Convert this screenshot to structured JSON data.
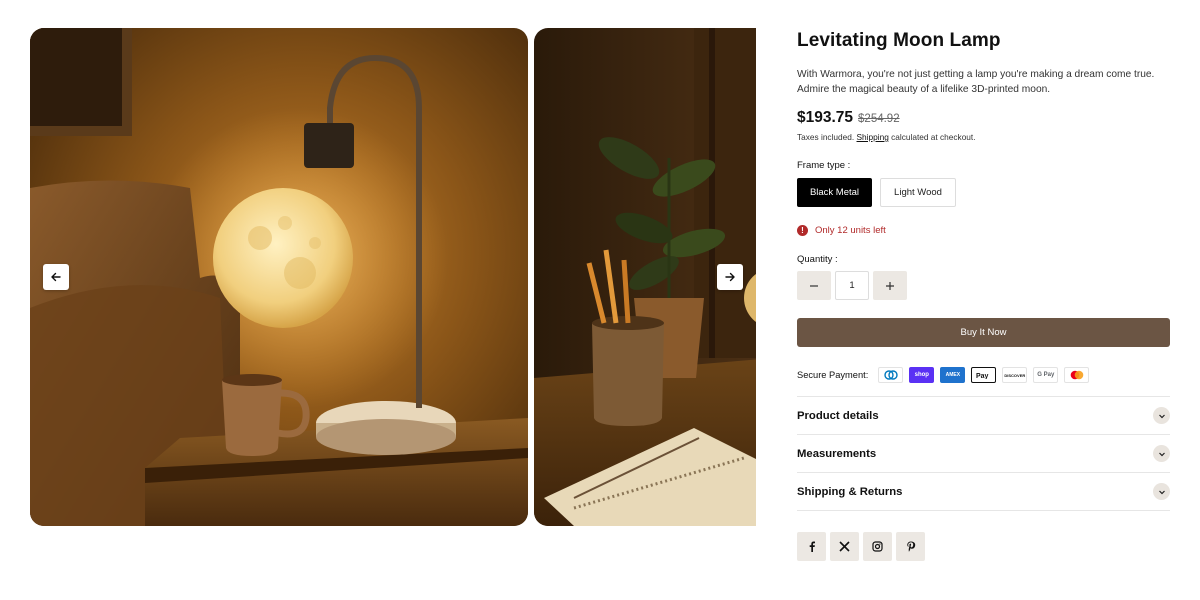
{
  "gallery": {
    "images": [
      {
        "alt": "Levitating Moon Lamp on side table"
      },
      {
        "alt": "Moon lamp with plant and notebook"
      }
    ],
    "prev_icon": "arrow-left-icon",
    "next_icon": "arrow-right-icon"
  },
  "product": {
    "title": "Levitating Moon Lamp",
    "description": "With Warmora, you're not just getting a lamp you're making a dream come true. Admire the magical beauty of a lifelike 3D-printed moon.",
    "price": "$193.75",
    "compare_price": "$254.92",
    "tax_prefix": "Taxes included.",
    "tax_link": "Shipping",
    "tax_suffix": "calculated at checkout."
  },
  "frame": {
    "label": "Frame type :",
    "options": [
      "Black Metal",
      "Light Wood"
    ],
    "selected": "Black Metal"
  },
  "stock": {
    "icon": "alert-icon",
    "text": "Only 12 units left",
    "color": "#b12a2a"
  },
  "quantity": {
    "label": "Quantity :",
    "value": "1",
    "minus_icon": "minus-icon",
    "plus_icon": "plus-icon"
  },
  "buy": {
    "label": "Buy It Now",
    "color": "#6b5544"
  },
  "payment": {
    "label": "Secure Payment:",
    "methods": [
      "Diners Club",
      "shop",
      "AMEX",
      "Apple Pay",
      "DISCOVER",
      "G Pay",
      "Mastercard"
    ]
  },
  "accordion": {
    "items": [
      {
        "title": "Product details"
      },
      {
        "title": "Measurements"
      },
      {
        "title": "Shipping & Returns"
      }
    ]
  },
  "social": {
    "items": [
      "facebook-icon",
      "x-icon",
      "instagram-icon",
      "pinterest-icon"
    ]
  }
}
